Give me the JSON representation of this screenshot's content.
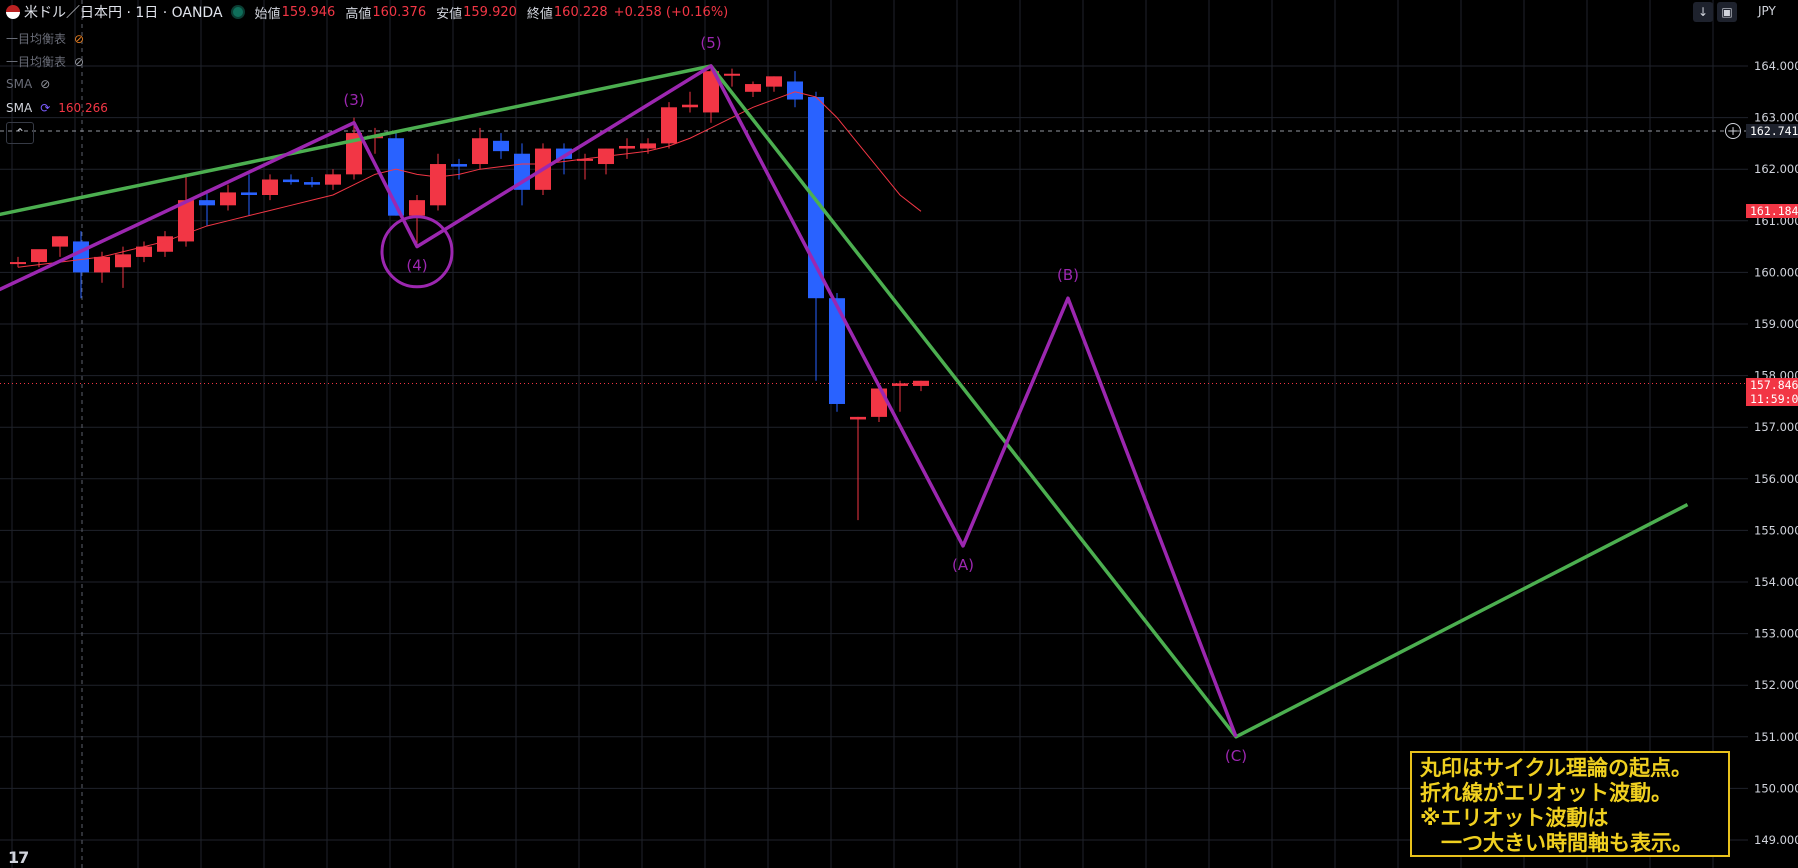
{
  "header": {
    "symbol": "米ドル／日本円 · 1日 · OANDA",
    "open_label": "始値",
    "open": "159.946",
    "high_label": "高値",
    "high": "160.376",
    "low_label": "安値",
    "low": "159.920",
    "close_label": "終値",
    "close": "160.228",
    "change": "+0.258 (+0.16%)"
  },
  "indicators": [
    {
      "name": "一目均衡表",
      "value": "",
      "visible": false,
      "icon": "eye-off-icon"
    },
    {
      "name": "一目均衡表",
      "value": "",
      "visible": false,
      "icon": "eye-off-icon"
    },
    {
      "name": "SMA",
      "value": "",
      "visible": false,
      "icon": "eye-off-icon"
    },
    {
      "name": "SMA",
      "value": "160.266",
      "visible": true,
      "icon": "refresh-icon"
    }
  ],
  "currency": "JPY",
  "price_tags": {
    "crosshair": "162.741",
    "sma": "161.184",
    "last": "157.846",
    "countdown": "11:59:0"
  },
  "note": {
    "lines": [
      "丸印はサイクル理論の起点。",
      "折れ線がエリオット波動。",
      "※エリオット波動は",
      "　一つ大きい時間軸も表示。"
    ],
    "color": "#f0d020"
  },
  "colors": {
    "up": "#f23645",
    "down": "#2962ff",
    "elliott": "#9c27b0",
    "trend": "#4caf50",
    "sma": "#f23645"
  },
  "chart_data": {
    "type": "candlestick",
    "y_ticks": [
      "164.000",
      "163.000",
      "162.000",
      "161.000",
      "160.000",
      "159.000",
      "158.000",
      "157.000",
      "156.000",
      "155.000",
      "154.000",
      "153.000",
      "152.000",
      "151.000",
      "150.000",
      "149.000"
    ],
    "ylim": [
      148.7,
      164.9
    ],
    "candles": [
      {
        "o": 160.2,
        "h": 160.3,
        "l": 160.1,
        "c": 160.2
      },
      {
        "o": 160.2,
        "h": 160.4,
        "l": 160.1,
        "c": 160.45
      },
      {
        "o": 160.5,
        "h": 160.7,
        "l": 160.3,
        "c": 160.7
      },
      {
        "o": 160.6,
        "h": 160.8,
        "l": 159.5,
        "c": 160.0
      },
      {
        "o": 160.0,
        "h": 160.4,
        "l": 159.8,
        "c": 160.3
      },
      {
        "o": 160.1,
        "h": 160.5,
        "l": 159.7,
        "c": 160.35
      },
      {
        "o": 160.3,
        "h": 160.6,
        "l": 160.2,
        "c": 160.5
      },
      {
        "o": 160.4,
        "h": 160.8,
        "l": 160.3,
        "c": 160.7
      },
      {
        "o": 160.6,
        "h": 161.9,
        "l": 160.5,
        "c": 161.4
      },
      {
        "o": 161.4,
        "h": 161.6,
        "l": 160.9,
        "c": 161.3
      },
      {
        "o": 161.3,
        "h": 161.7,
        "l": 161.2,
        "c": 161.55
      },
      {
        "o": 161.55,
        "h": 161.9,
        "l": 161.1,
        "c": 161.5
      },
      {
        "o": 161.5,
        "h": 161.9,
        "l": 161.4,
        "c": 161.8
      },
      {
        "o": 161.8,
        "h": 161.9,
        "l": 161.7,
        "c": 161.75
      },
      {
        "o": 161.75,
        "h": 161.85,
        "l": 161.65,
        "c": 161.7
      },
      {
        "o": 161.7,
        "h": 162.0,
        "l": 161.6,
        "c": 161.9
      },
      {
        "o": 161.9,
        "h": 163.0,
        "l": 161.8,
        "c": 162.7
      },
      {
        "o": 162.6,
        "h": 162.8,
        "l": 162.3,
        "c": 162.65
      },
      {
        "o": 162.6,
        "h": 162.7,
        "l": 161.1,
        "c": 161.1
      },
      {
        "o": 161.1,
        "h": 161.5,
        "l": 160.5,
        "c": 161.4
      },
      {
        "o": 161.3,
        "h": 162.3,
        "l": 161.2,
        "c": 162.1
      },
      {
        "o": 162.1,
        "h": 162.2,
        "l": 161.8,
        "c": 162.05
      },
      {
        "o": 162.1,
        "h": 162.8,
        "l": 162.0,
        "c": 162.6
      },
      {
        "o": 162.55,
        "h": 162.7,
        "l": 162.2,
        "c": 162.35
      },
      {
        "o": 162.3,
        "h": 162.5,
        "l": 161.3,
        "c": 161.6
      },
      {
        "o": 161.6,
        "h": 162.5,
        "l": 161.5,
        "c": 162.4
      },
      {
        "o": 162.4,
        "h": 162.5,
        "l": 161.9,
        "c": 162.2
      },
      {
        "o": 162.2,
        "h": 162.3,
        "l": 161.8,
        "c": 162.2
      },
      {
        "o": 162.1,
        "h": 162.4,
        "l": 161.9,
        "c": 162.4
      },
      {
        "o": 162.4,
        "h": 162.6,
        "l": 162.2,
        "c": 162.45
      },
      {
        "o": 162.4,
        "h": 162.6,
        "l": 162.3,
        "c": 162.5
      },
      {
        "o": 162.5,
        "h": 163.3,
        "l": 162.4,
        "c": 163.2
      },
      {
        "o": 163.2,
        "h": 163.5,
        "l": 163.1,
        "c": 163.25
      },
      {
        "o": 163.1,
        "h": 164.0,
        "l": 162.9,
        "c": 163.9
      },
      {
        "o": 163.85,
        "h": 163.95,
        "l": 163.6,
        "c": 163.85
      },
      {
        "o": 163.5,
        "h": 163.7,
        "l": 163.4,
        "c": 163.65
      },
      {
        "o": 163.6,
        "h": 163.8,
        "l": 163.5,
        "c": 163.8
      },
      {
        "o": 163.7,
        "h": 163.9,
        "l": 163.2,
        "c": 163.35
      },
      {
        "o": 163.4,
        "h": 163.5,
        "l": 157.9,
        "c": 159.5
      },
      {
        "o": 159.5,
        "h": 159.6,
        "l": 157.3,
        "c": 157.45
      },
      {
        "o": 157.15,
        "h": 157.2,
        "l": 155.2,
        "c": 157.2
      },
      {
        "o": 157.2,
        "h": 157.8,
        "l": 157.1,
        "c": 157.75
      },
      {
        "o": 157.8,
        "h": 157.9,
        "l": 157.3,
        "c": 157.85
      },
      {
        "o": 157.8,
        "h": 157.9,
        "l": 157.7,
        "c": 157.9
      }
    ],
    "sma_series": [
      160.1,
      160.15,
      160.2,
      160.25,
      160.3,
      160.4,
      160.5,
      160.6,
      160.75,
      160.9,
      161.0,
      161.1,
      161.2,
      161.3,
      161.4,
      161.5,
      161.7,
      161.9,
      162.0,
      161.9,
      161.85,
      161.9,
      162.0,
      162.05,
      162.1,
      162.1,
      162.15,
      162.2,
      162.25,
      162.3,
      162.35,
      162.45,
      162.6,
      162.8,
      163.0,
      163.2,
      163.35,
      163.5,
      163.4,
      163.0,
      162.5,
      162.0,
      161.5,
      161.184
    ],
    "elliott_labels": [
      "(3)",
      "(4)",
      "(5)",
      "(A)",
      "(B)",
      "(C)"
    ],
    "elliott_points": [
      {
        "i": -1.5,
        "p": 159.55
      },
      {
        "i": 16,
        "p": 162.9
      },
      {
        "i": 19,
        "p": 160.5
      },
      {
        "i": 33,
        "p": 164.0
      },
      {
        "i": 45,
        "p": 154.7
      },
      {
        "i": 50,
        "p": 159.5
      },
      {
        "i": 58,
        "p": 151.0
      }
    ],
    "trend_points": [
      {
        "i": -3.5,
        "p": 160.9
      },
      {
        "i": 33,
        "p": 164.0
      },
      {
        "i": 58,
        "p": 151.0
      },
      {
        "i": 79.5,
        "p": 155.5
      }
    ],
    "cycle_circle": {
      "i": 19,
      "p": 160.4
    },
    "crosshair_price": 162.741,
    "last_price": 157.846
  }
}
